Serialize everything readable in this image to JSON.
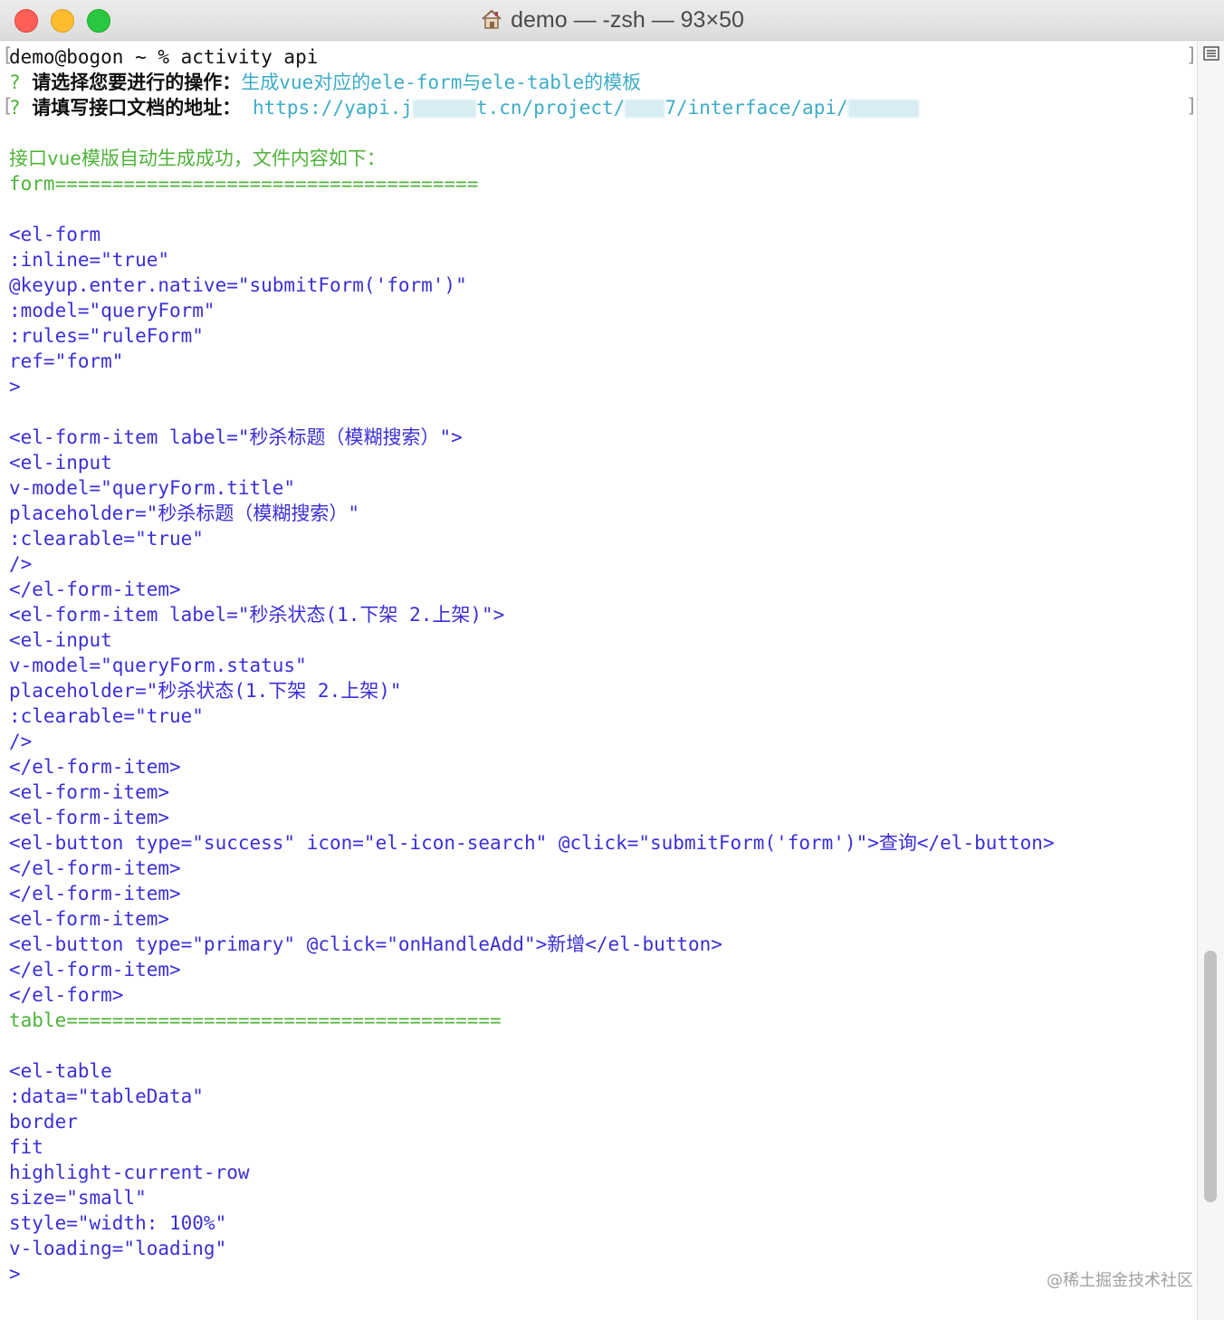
{
  "window": {
    "title": "demo — -zsh — 93×50"
  },
  "terminal": {
    "prompt_line": "demo@bogon ~ % activity api",
    "question1": {
      "mark": "? ",
      "label": "请选择您要进行的操作：",
      "answer": "生成vue对应的ele-form与ele-table的模板"
    },
    "question2": {
      "mark": "? ",
      "label": "请填写接口文档的地址：",
      "answer_prefix": " https://yapi.j",
      "answer_mid1": "t.cn/project/",
      "answer_mid2": "7/interface/api/"
    },
    "success_msg": "接口vue模版自动生成成功，文件内容如下：",
    "form_sep": "form=====================================",
    "form_lines": [
      "<el-form",
      ":inline=\"true\"",
      "@keyup.enter.native=\"submitForm('form')\"",
      ":model=\"queryForm\"",
      ":rules=\"ruleForm\"",
      "ref=\"form\"",
      ">",
      "",
      "<el-form-item label=\"秒杀标题（模糊搜索）\">",
      "<el-input",
      "v-model=\"queryForm.title\"",
      "placeholder=\"秒杀标题（模糊搜索）\"",
      ":clearable=\"true\"",
      "/>",
      "</el-form-item>",
      "<el-form-item label=\"秒杀状态(1.下架 2.上架)\">",
      "<el-input",
      "v-model=\"queryForm.status\"",
      "placeholder=\"秒杀状态(1.下架 2.上架)\"",
      ":clearable=\"true\"",
      "/>",
      "</el-form-item>",
      "<el-form-item>",
      "<el-form-item>",
      "<el-button type=\"success\" icon=\"el-icon-search\" @click=\"submitForm('form')\">查询</el-button>",
      "</el-form-item>",
      "</el-form-item>",
      "<el-form-item>",
      "<el-button type=\"primary\" @click=\"onHandleAdd\">新增</el-button>",
      "</el-form-item>",
      "</el-form>"
    ],
    "table_sep": "table======================================",
    "table_lines": [
      "",
      "<el-table",
      ":data=\"tableData\"",
      "border",
      "fit",
      "highlight-current-row",
      "size=\"small\"",
      "style=\"width: 100%\"",
      "v-loading=\"loading\"",
      ">"
    ]
  },
  "watermark": "@稀土掘金技术社区",
  "icons": {
    "home": "home-icon",
    "menu": "list-icon"
  },
  "colors": {
    "code": "#3b2fd6",
    "success": "#4fb33a",
    "answer": "#3dacc7"
  }
}
